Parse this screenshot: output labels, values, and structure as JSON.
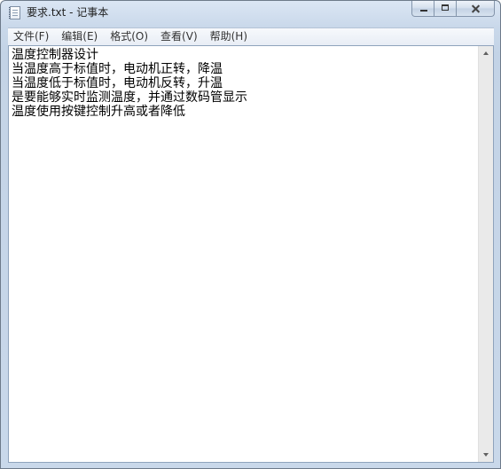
{
  "window": {
    "title": "要求.txt - 记事本"
  },
  "menu": [
    {
      "label": "文件(F)"
    },
    {
      "label": "编辑(E)"
    },
    {
      "label": "格式(O)"
    },
    {
      "label": "查看(V)"
    },
    {
      "label": "帮助(H)"
    }
  ],
  "document": {
    "lines": [
      "温度控制器设计",
      "当温度高于标值时，电动机正转，降温",
      "当温度低于标值时，电动机反转，升温",
      "是要能够实时监测温度，并通过数码管显示",
      "温度使用按键控制升高或者降低"
    ]
  },
  "icons": {
    "app": "notepad-document-icon",
    "minimize": "minimize-icon",
    "maximize": "maximize-icon",
    "close": "close-icon",
    "scroll_up": "scroll-up-arrow-icon",
    "scroll_down": "scroll-down-arrow-icon"
  }
}
